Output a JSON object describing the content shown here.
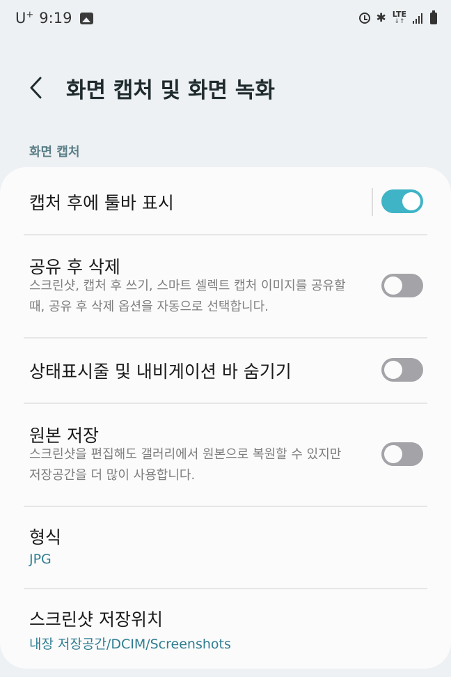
{
  "status_bar": {
    "carrier": "U",
    "carrier_plus": "+",
    "time": "9:19",
    "icons": [
      "gallery-icon",
      "alarm-icon",
      "bluetooth-icon",
      "lte-icon",
      "signal-icon",
      "battery-icon"
    ],
    "network": "LTE",
    "network_arrows": "↓↑"
  },
  "header": {
    "back_icon": "chevron-left-icon",
    "title": "화면 캡처 및 화면 녹화"
  },
  "section": {
    "label": "화면 캡처"
  },
  "settings": {
    "toolbar": {
      "title": "캡처 후에 툴바 표시",
      "enabled": true
    },
    "delete_after_share": {
      "title": "공유 후 삭제",
      "description": "스크린샷, 캡처 후 쓰기, 스마트 셀렉트 캡처 이미지를 공유할 때, 공유 후 삭제 옵션을 자동으로 선택합니다.",
      "enabled": false
    },
    "hide_bars": {
      "title": "상태표시줄 및 내비게이션 바 숨기기",
      "enabled": false
    },
    "save_original": {
      "title": "원본 저장",
      "description": "스크린샷을 편집해도 갤러리에서 원본으로 복원할 수 있지만 저장공간을 더 많이 사용합니다.",
      "enabled": false
    },
    "format": {
      "title": "형식",
      "value": "JPG"
    },
    "save_location": {
      "title": "스크린샷 저장위치",
      "value": "내장 저장공간/DCIM/Screenshots"
    }
  },
  "colors": {
    "accent": "#3eb4c6",
    "value_text": "#2e7d91",
    "section_label": "#5b7f86",
    "toggle_off": "#a3a3a8",
    "background": "#eef1f3",
    "card": "#fbfbfb"
  }
}
